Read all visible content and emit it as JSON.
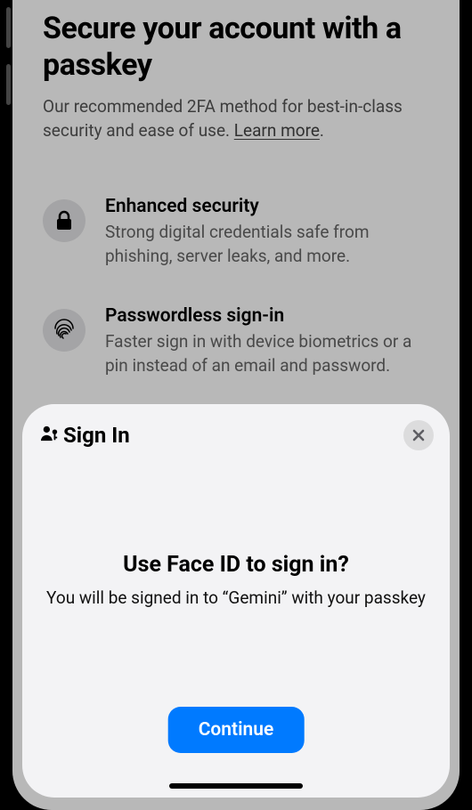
{
  "bg": {
    "heading": "Secure your account with a passkey",
    "subheading_before": "Our recommended 2FA method for best-in-class security and ease of use. ",
    "learn_more": "Learn more",
    "period": ".",
    "features": [
      {
        "title": "Enhanced security",
        "desc": "Strong digital credentials safe from phishing, server leaks, and more."
      },
      {
        "title": "Passwordless sign-in",
        "desc": "Faster sign in with device biometrics or a pin instead of an email and password."
      }
    ]
  },
  "sheet": {
    "signin_label": "Sign In",
    "title": "Use Face ID to sign in?",
    "desc": "You will be signed in to “Gemini” with your passkey",
    "continue_label": "Continue"
  },
  "colors": {
    "accent": "#007aff"
  }
}
